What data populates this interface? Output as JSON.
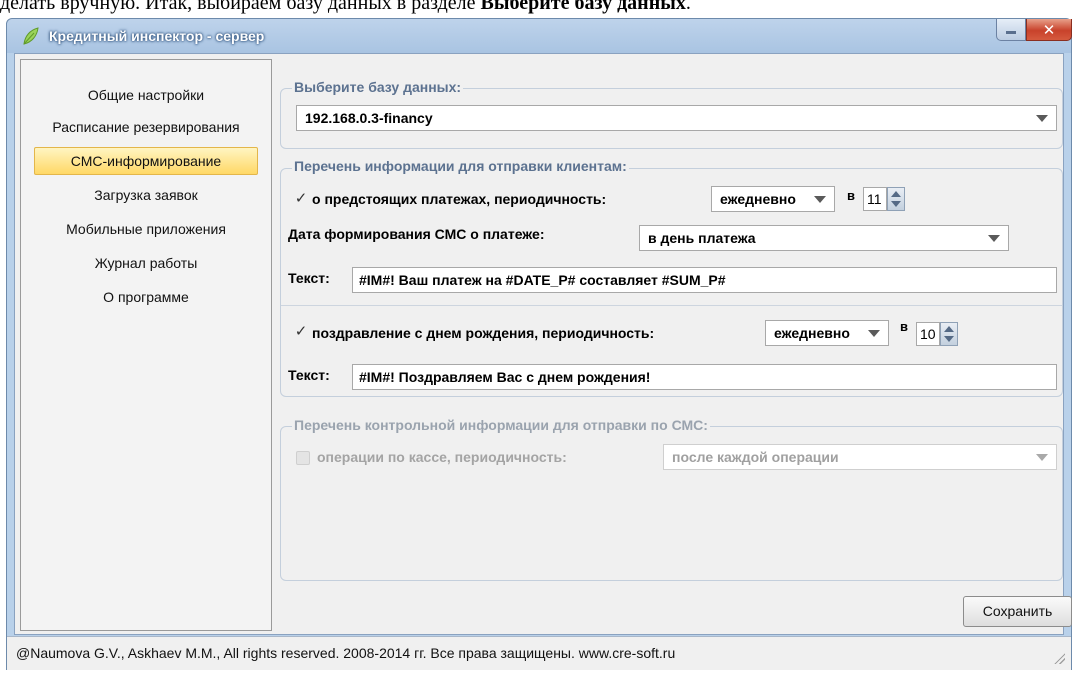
{
  "doc_text": {
    "prefix": "делать вручную. Итак, выбираем базу данных в разделе ",
    "bold": "Выберите базу данных",
    "suffix": "."
  },
  "window": {
    "title": "Кредитный инспектор - сервер",
    "close_glyph": "✕"
  },
  "sidebar": {
    "items": [
      {
        "label": "Общие настройки"
      },
      {
        "label": "Расписание резервирования"
      },
      {
        "label": "СМС-информирование"
      },
      {
        "label": "Загрузка заявок"
      },
      {
        "label": "Мобильные приложения"
      },
      {
        "label": "Журнал работы"
      },
      {
        "label": "О программе"
      }
    ],
    "active_index": 2
  },
  "database": {
    "group_title": "Выберите базу данных:",
    "selected": "192.168.0.3-financy"
  },
  "client_info": {
    "group_title": "Перечень информации для отправки клиентам:",
    "payments": {
      "checked": true,
      "check_glyph": "✓",
      "label": "о предстоящих платежах, периодичность:",
      "period": "ежедневно",
      "at_label": "в",
      "hour": "11",
      "date_label": "Дата формирования СМС о платеже:",
      "date_value": "в день платежа",
      "text_label": "Текст:",
      "text_value": "#IM#! Ваш платеж на #DATE_P# составляет #SUM_P#"
    },
    "birthday": {
      "checked": true,
      "check_glyph": "✓",
      "label": "поздравление с днем рождения, периодичность:",
      "period": "ежедневно",
      "at_label": "в",
      "hour": "10",
      "text_label": "Текст:",
      "text_value": "#IM#! Поздравляем Вас с днем рождения!"
    }
  },
  "control_info": {
    "group_title": "Перечень контрольной информации для отправки по СМС:",
    "cash": {
      "checked": false,
      "enabled": false,
      "label": "операции по кассе, периодичность:",
      "period": "после каждой операции"
    }
  },
  "save_label": "Сохранить",
  "status_text": "@Naumova G.V., Askhaev M.M., All rights reserved. 2008-2014 гг. Все права защищены. www.cre-soft.ru",
  "colors": {
    "title_bar": "#a9c4e2",
    "active_item": "#ffd866",
    "group_title": "#5c7290",
    "close_button": "#c8422b"
  }
}
